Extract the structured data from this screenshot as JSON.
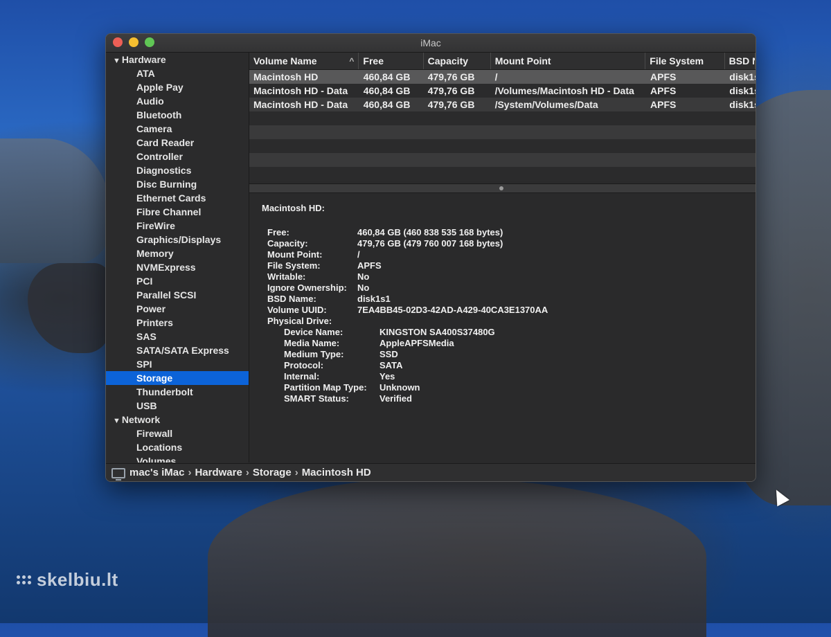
{
  "window": {
    "title": "iMac"
  },
  "sidebar": {
    "hardware_header": "Hardware",
    "hardware_items": [
      "ATA",
      "Apple Pay",
      "Audio",
      "Bluetooth",
      "Camera",
      "Card Reader",
      "Controller",
      "Diagnostics",
      "Disc Burning",
      "Ethernet Cards",
      "Fibre Channel",
      "FireWire",
      "Graphics/Displays",
      "Memory",
      "NVMExpress",
      "PCI",
      "Parallel SCSI",
      "Power",
      "Printers",
      "SAS",
      "SATA/SATA Express",
      "SPI",
      "Storage",
      "Thunderbolt",
      "USB"
    ],
    "selected": "Storage",
    "network_header": "Network",
    "network_items": [
      "Firewall",
      "Locations",
      "Volumes"
    ]
  },
  "table": {
    "columns": [
      "Volume Name",
      "Free",
      "Capacity",
      "Mount Point",
      "File System",
      "BSD N"
    ],
    "sort_indicator": "^",
    "rows": [
      [
        "Macintosh HD",
        "460,84 GB",
        "479,76 GB",
        "/",
        "APFS",
        "disk1s"
      ],
      [
        "Macintosh HD - Data",
        "460,84 GB",
        "479,76 GB",
        "/Volumes/Macintosh HD - Data",
        "APFS",
        "disk1s"
      ],
      [
        "Macintosh HD - Data",
        "460,84 GB",
        "479,76 GB",
        "/System/Volumes/Data",
        "APFS",
        "disk1s"
      ]
    ]
  },
  "detail": {
    "title": "Macintosh HD:",
    "fields": [
      {
        "k": "Free:",
        "v": "460,84 GB (460 838 535 168 bytes)"
      },
      {
        "k": "Capacity:",
        "v": "479,76 GB (479 760 007 168 bytes)"
      },
      {
        "k": "Mount Point:",
        "v": "/"
      },
      {
        "k": "File System:",
        "v": "APFS"
      },
      {
        "k": "Writable:",
        "v": "No"
      },
      {
        "k": "Ignore Ownership:",
        "v": "No"
      },
      {
        "k": "BSD Name:",
        "v": "disk1s1"
      },
      {
        "k": "Volume UUID:",
        "v": "7EA4BB45-02D3-42AD-A429-40CA3E1370AA"
      },
      {
        "k": "Physical Drive:",
        "v": ""
      }
    ],
    "physical_drive": [
      {
        "k": "Device Name:",
        "v": "KINGSTON SA400S37480G"
      },
      {
        "k": "Media Name:",
        "v": "AppleAPFSMedia"
      },
      {
        "k": "Medium Type:",
        "v": "SSD"
      },
      {
        "k": "Protocol:",
        "v": "SATA"
      },
      {
        "k": "Internal:",
        "v": "Yes"
      },
      {
        "k": "Partition Map Type:",
        "v": "Unknown"
      },
      {
        "k": "SMART Status:",
        "v": "Verified"
      }
    ]
  },
  "pathbar": {
    "crumbs": [
      "mac's iMac",
      "Hardware",
      "Storage",
      "Macintosh HD"
    ],
    "separator": "›"
  },
  "watermark": "skelbiu.lt"
}
